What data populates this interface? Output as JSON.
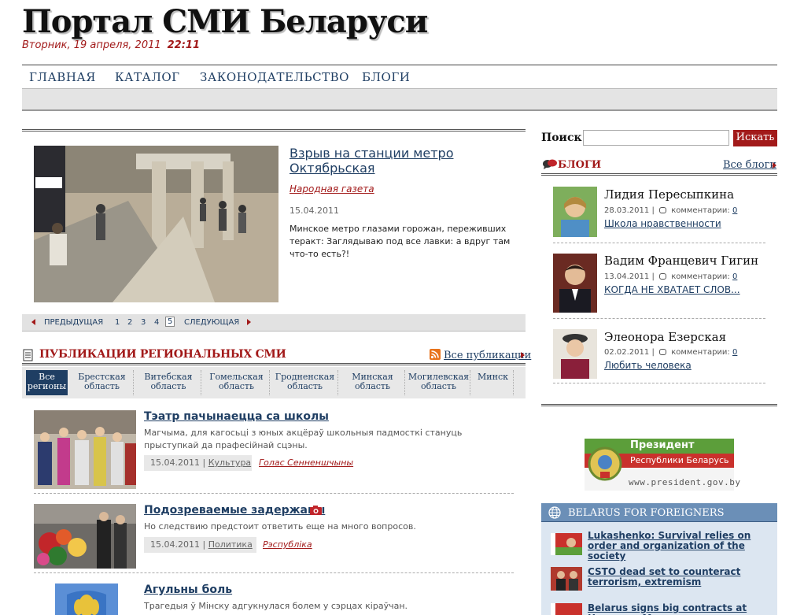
{
  "header": {
    "site_title": "Портал СМИ Беларуси",
    "date": "Вторник, 19 апреля, 2011",
    "time": "22:11"
  },
  "nav": {
    "items": [
      "ГЛАВНАЯ",
      "КАТАЛОГ",
      "ЗАКОНОДАТЕЛЬСТВО",
      "БЛОГИ"
    ]
  },
  "feature": {
    "title": "Взрыв на станции метро Октябрьская",
    "source": "Народная газета",
    "date": "15.04.2011",
    "text": "Минское метро глазами горожан, переживших теракт: Заглядываю под все лавки: а вдруг там что-то есть?!",
    "pager": {
      "prev": "ПРЕДЫДУЩАЯ",
      "pages": [
        "1",
        "2",
        "3",
        "4",
        "5"
      ],
      "current": "5",
      "next": "СЛЕДУЮЩАЯ"
    }
  },
  "publications": {
    "title": "ПУБЛИКАЦИИ РЕГИОНАЛЬНЫХ СМИ",
    "all_label": "Все публикации",
    "tabs": [
      "Все регионы",
      "Брестская область",
      "Витебская область",
      "Гомельская область",
      "Гродненская область",
      "Минская область",
      "Могилевская область",
      "Минск"
    ],
    "items": [
      {
        "title": "Тэатр пачынаецца са школы",
        "text": "Магчыма, для кагосьці з юных акцёраў школьныя падмосткі стануць прыступкай да прафесійнай сцэны.",
        "date": "15.04.2011",
        "category": "Культура",
        "source": "Голас Сенненшчыны"
      },
      {
        "title": "Подозреваемые задержаны",
        "text": "Но следствию предстоит ответить еще на много вопросов.",
        "date": "15.04.2011",
        "category": "Политика",
        "source": "Рэспубліка"
      },
      {
        "title": "Агульны боль",
        "text": "Трагедыя ў Мінску адгукнулася болем у сэрцах кіраўчан."
      }
    ]
  },
  "search": {
    "label": "Поиск",
    "value": "",
    "button": "Искать"
  },
  "blogs": {
    "title": "БЛОГИ",
    "all_label": "Все блоги",
    "comments_label": "комментарии:",
    "items": [
      {
        "name": "Лидия Пересыпкина",
        "date": "28.03.2011",
        "comments": "0",
        "post": "Школа нравственности"
      },
      {
        "name": "Вадим Францевич Гигин",
        "date": "13.04.2011",
        "comments": "0",
        "post": "КОГДА НЕ ХВАТАЕТ СЛОВ..."
      },
      {
        "name": "Элеонора Езерская",
        "date": "02.02.2011",
        "comments": "0",
        "post": "Любить человека"
      }
    ]
  },
  "president_banner": {
    "line1": "Президент",
    "line2": "Республики Беларусь",
    "url": "www.president.gov.by"
  },
  "foreigners": {
    "title": "BELARUS FOR FOREIGNERS",
    "items": [
      "Lukashenko: Survival relies on order and organization of the society",
      "CSTO dead set to counteract terrorism, extremism",
      "Belarus signs big contracts at Hannover M"
    ]
  },
  "colors": {
    "accent_red": "#a21a1a",
    "link_blue": "#1f3e63",
    "foreigners_blue": "#6b8fb7"
  }
}
